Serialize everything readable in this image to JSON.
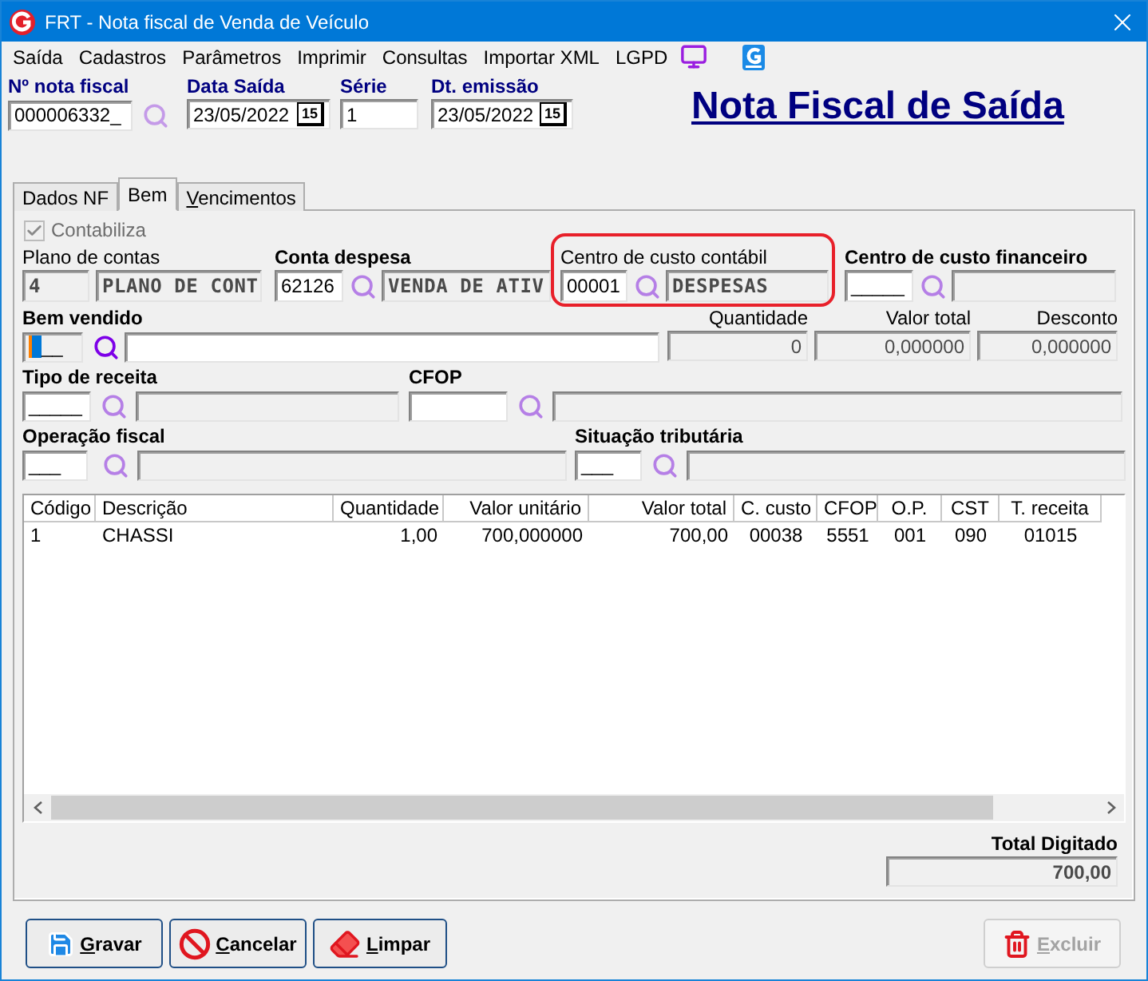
{
  "window": {
    "title": "FRT - Nota fiscal de Venda de Veículo"
  },
  "menu": [
    {
      "label": "Saída"
    },
    {
      "label": "Cadastros"
    },
    {
      "label": "Parâmetros"
    },
    {
      "label": "Imprimir"
    },
    {
      "label": "Consultas"
    },
    {
      "label": "Importar XML"
    },
    {
      "label": "LGPD"
    }
  ],
  "header": {
    "nota_fiscal": {
      "label": "Nº nota fiscal",
      "value": "000006332_"
    },
    "data_saida": {
      "label": "Data Saída",
      "value": "23/05/2022",
      "calendar": "15"
    },
    "serie": {
      "label": "Série",
      "value": "1"
    },
    "dt_emissao": {
      "label": "Dt. emissão",
      "value": "23/05/2022",
      "calendar": "15"
    },
    "title": "Nota Fiscal de Saída"
  },
  "tabs": [
    {
      "label": "Dados NF",
      "selected": false,
      "shortcut": false
    },
    {
      "label": "Bem",
      "selected": true,
      "shortcut": false
    },
    {
      "label": "Vencimentos",
      "selected": false,
      "shortcut": true
    }
  ],
  "form": {
    "contabiliza": {
      "label": "Contabiliza",
      "checked": true,
      "disabled": true
    },
    "plano_de_contas": {
      "label": "Plano de contas",
      "code": "4",
      "description": "PLANO DE CONT"
    },
    "conta_despesa": {
      "label": "Conta despesa",
      "code": "62126",
      "description": "VENDA DE ATIV"
    },
    "centro_custo_contabil": {
      "label": "Centro de custo contábil",
      "code": "00001",
      "description": "DESPESAS",
      "highlighted": true
    },
    "centro_custo_financeiro": {
      "label": "Centro de custo financeiro",
      "code": "_____"
    },
    "bem_vendido": {
      "label": "Bem vendido",
      "code": "__",
      "focused": true
    },
    "quantidade": {
      "label": "Quantidade",
      "value": "0"
    },
    "valor_total": {
      "label": "Valor total",
      "value": "0,000000"
    },
    "desconto": {
      "label": "Desconto",
      "value": "0,000000"
    },
    "tipo_receita": {
      "label": "Tipo de receita",
      "code": "_____"
    },
    "cfop": {
      "label": "CFOP"
    },
    "operacao_fiscal": {
      "label": "Operação fiscal",
      "code": "___"
    },
    "situacao_tributaria": {
      "label": "Situação tributária",
      "code": "___"
    }
  },
  "table": {
    "columns": [
      {
        "label": "Código"
      },
      {
        "label": "Descrição"
      },
      {
        "label": "Quantidade"
      },
      {
        "label": "Valor unitário"
      },
      {
        "label": "Valor total"
      },
      {
        "label": "C. custo"
      },
      {
        "label": "CFOP"
      },
      {
        "label": "O.P."
      },
      {
        "label": "CST"
      },
      {
        "label": "T. receita"
      }
    ],
    "rows": [
      {
        "cells": [
          "1",
          "CHASSI",
          "1,00",
          "700,000000",
          "700,00",
          "00038",
          "5551",
          "001",
          "090",
          "01015"
        ],
        "selected": false
      }
    ]
  },
  "total": {
    "label": "Total Digitado",
    "value": "700,00"
  },
  "buttons": [
    {
      "label": "Gravar",
      "kind": "save",
      "disabled": false
    },
    {
      "label": "Cancelar",
      "kind": "cancel",
      "disabled": false
    },
    {
      "label": "Limpar",
      "kind": "clear",
      "disabled": false
    },
    {
      "label": "Excluir",
      "kind": "delete",
      "disabled": true
    }
  ]
}
